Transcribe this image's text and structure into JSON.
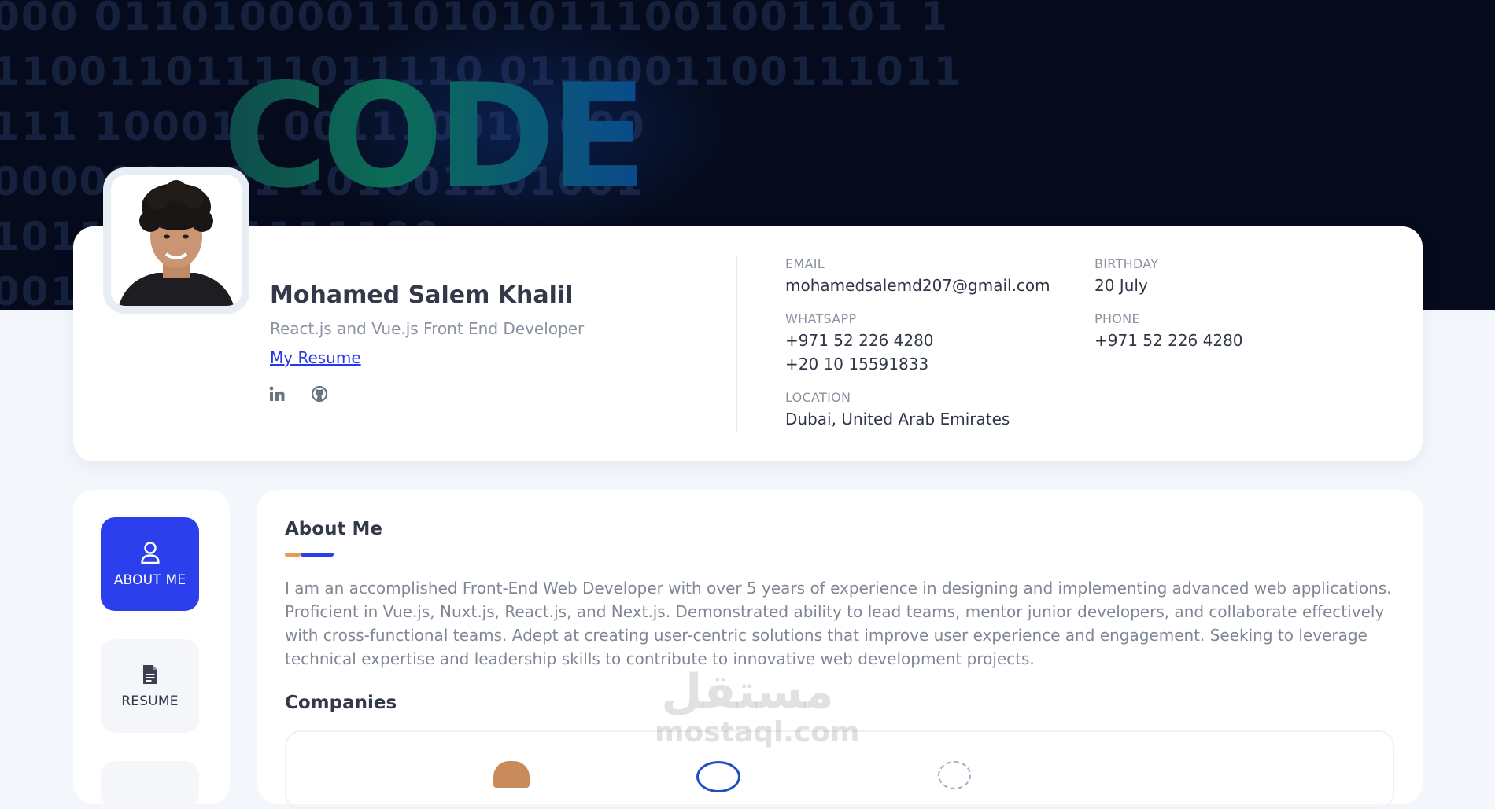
{
  "hero": {
    "code_word": "CODE",
    "binary_rows": [
      "000  0110100001101010111001001101  1",
      "11001101111011110  0110001100111011",
      "111  100011       001110010  000",
      "0000000101        101001101001",
      "10110100          1111100",
      "00110"
    ]
  },
  "profile": {
    "name": "Mohamed Salem Khalil",
    "role": "React.js and Vue.js Front End Developer",
    "resume_link": "My Resume",
    "socials": [
      {
        "icon": "linkedin-icon",
        "label": "in"
      },
      {
        "icon": "github-icon",
        "label": "github"
      }
    ]
  },
  "contact": {
    "email": {
      "label": "EMAIL",
      "value": "mohamedsalemd207@gmail.com"
    },
    "birthday": {
      "label": "BIRTHDAY",
      "value": "20 July"
    },
    "whatsapp": {
      "label": "WHATSAPP",
      "values": [
        "+971 52 226 4280",
        "+20 10 15591833"
      ]
    },
    "phone": {
      "label": "PHONE",
      "value": "+971 52 226 4280"
    },
    "location": {
      "label": "LOCATION",
      "value": "Dubai, United Arab Emirates"
    }
  },
  "nav": {
    "items": [
      {
        "label": "ABOUT ME",
        "icon": "user-icon",
        "active": true
      },
      {
        "label": "RESUME",
        "icon": "document-icon",
        "active": false
      }
    ]
  },
  "about": {
    "title": "About Me",
    "text": "I am an accomplished Front-End Web Developer with over 5 years of experience in designing and implementing advanced web applications. Proficient in Vue.js, Nuxt.js, React.js, and Next.js. Demonstrated ability to lead teams, mentor junior developers, and collaborate effectively with cross-functional teams. Adept at creating user-centric solutions that improve user experience and engagement. Seeking to leverage technical expertise and leadership skills to contribute to innovative web development projects."
  },
  "companies": {
    "title": "Companies"
  },
  "watermark": {
    "arabic": "مستقل",
    "latin": "mostaql.com"
  },
  "colors": {
    "accent": "#2c3fec",
    "accent_orange": "#e29a55",
    "hero_bg": "#050b1c"
  }
}
